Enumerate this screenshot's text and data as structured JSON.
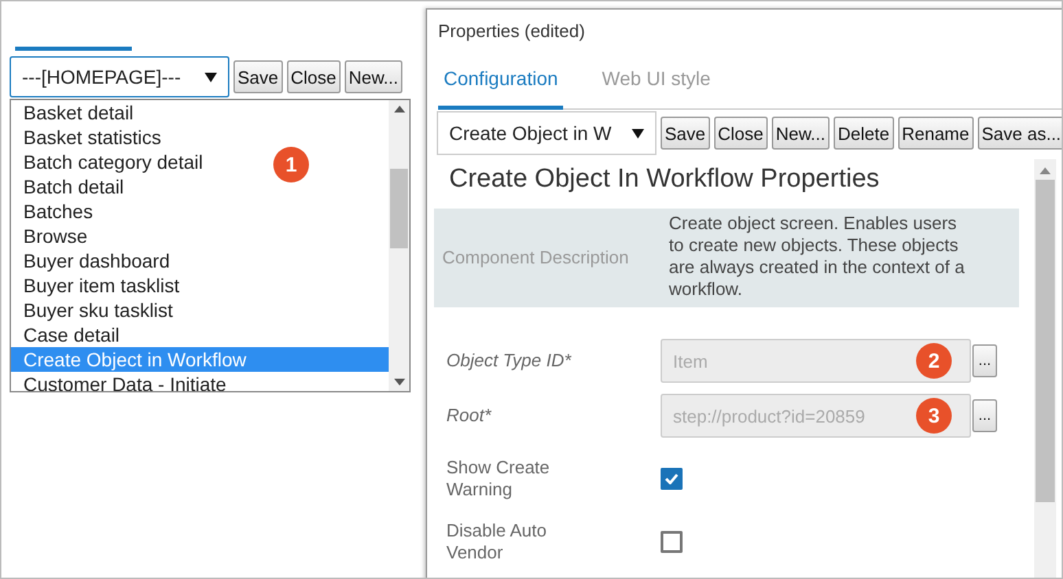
{
  "left_panel": {
    "toolbar": {
      "dropdown": "---[HOMEPAGE]---",
      "buttons": [
        "Save",
        "Close",
        "New..."
      ]
    },
    "dropdown_list": {
      "items": [
        {
          "label": "Basket detail",
          "selected": false
        },
        {
          "label": "Basket statistics",
          "selected": false
        },
        {
          "label": "Batch category detail",
          "selected": false
        },
        {
          "label": "Batch detail",
          "selected": false
        },
        {
          "label": "Batches",
          "selected": false
        },
        {
          "label": "Browse",
          "selected": false
        },
        {
          "label": "Buyer dashboard",
          "selected": false
        },
        {
          "label": "Buyer item tasklist",
          "selected": false
        },
        {
          "label": "Buyer sku tasklist",
          "selected": false
        },
        {
          "label": "Case detail",
          "selected": false
        },
        {
          "label": "Create Object in Workflow",
          "selected": true
        },
        {
          "label": "Customer Data - Initiate",
          "selected": false
        }
      ]
    },
    "badge": "1"
  },
  "properties_window": {
    "title": "Properties (edited)",
    "tabs": [
      {
        "label": "Configuration",
        "selected": true
      },
      {
        "label": "Web UI style",
        "selected": false
      }
    ],
    "toolbar": {
      "dropdown": "Create Object in W",
      "buttons": [
        "Save",
        "Close",
        "New...",
        "Delete",
        "Rename",
        "Save as..."
      ]
    },
    "heading": "Create Object In Workflow Properties",
    "description": {
      "label": "Component Description",
      "text": "Create object screen. Enables users to create new objects. These objects are always created in the context of a workflow."
    },
    "fields": [
      {
        "kind": "text",
        "label": "Object Type ID*",
        "value": "Item",
        "disabled": true,
        "badge": "2",
        "button": "..."
      },
      {
        "kind": "text",
        "label": "Root*",
        "value": "step://product?id=20859",
        "disabled": true,
        "badge": "3",
        "button": "..."
      },
      {
        "kind": "checkbox",
        "label": "Show Create Warning",
        "checked": true
      },
      {
        "kind": "checkbox",
        "label": "Disable Auto Vendor",
        "checked": false
      }
    ]
  }
}
